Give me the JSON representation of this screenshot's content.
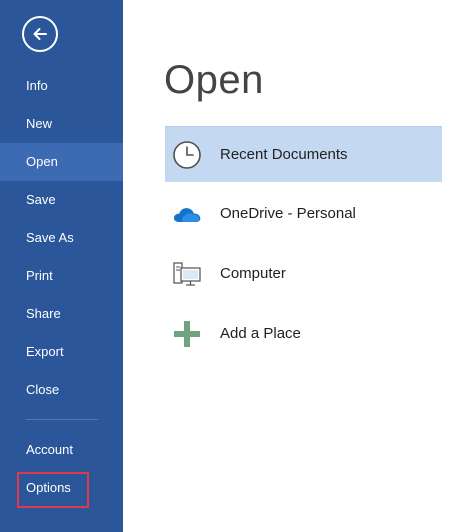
{
  "sidebar": {
    "back_icon": "back-arrow-icon",
    "items": [
      {
        "label": "Info",
        "selected": false
      },
      {
        "label": "New",
        "selected": false
      },
      {
        "label": "Open",
        "selected": true
      },
      {
        "label": "Save",
        "selected": false
      },
      {
        "label": "Save As",
        "selected": false
      },
      {
        "label": "Print",
        "selected": false
      },
      {
        "label": "Share",
        "selected": false
      },
      {
        "label": "Export",
        "selected": false
      },
      {
        "label": "Close",
        "selected": false
      }
    ],
    "bottom_items": [
      {
        "label": "Account"
      },
      {
        "label": "Options",
        "highlighted": true
      }
    ]
  },
  "main": {
    "title": "Open",
    "locations": [
      {
        "label": "Recent Documents",
        "icon": "clock-icon",
        "selected": true
      },
      {
        "label": "OneDrive - Personal",
        "icon": "cloud-icon",
        "selected": false
      },
      {
        "label": "Computer",
        "icon": "computer-icon",
        "selected": false
      },
      {
        "label": "Add a Place",
        "icon": "plus-icon",
        "selected": false
      }
    ]
  },
  "colors": {
    "sidebar_bg": "#2b579a",
    "sidebar_selected": "#3d6bb3",
    "recent_selected_bg": "#c5d8f1",
    "highlight_box": "#e0394b",
    "onedrive_blue": "#0f6cbd",
    "add_place_green": "#70a37f"
  }
}
